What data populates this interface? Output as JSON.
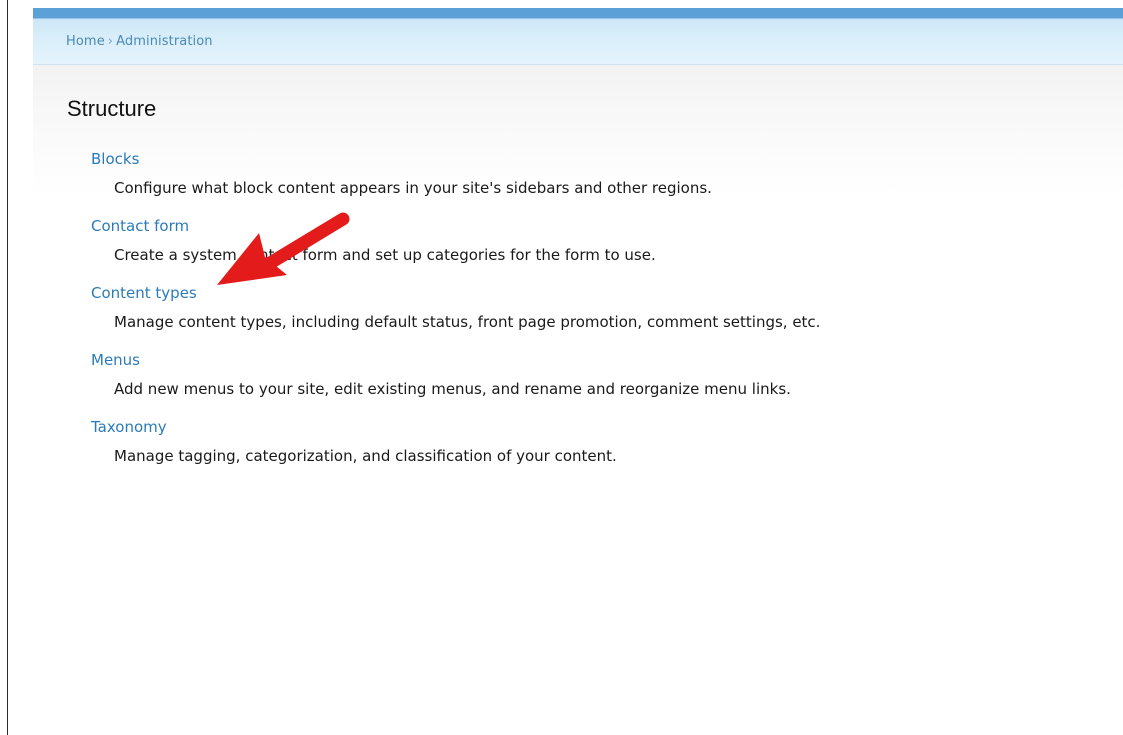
{
  "breadcrumb": {
    "home": "Home",
    "separator": "›",
    "current": "Administration"
  },
  "page": {
    "title": "Structure"
  },
  "items": [
    {
      "label": "Blocks",
      "description": "Configure what block content appears in your site's sidebars and other regions."
    },
    {
      "label": "Contact form",
      "description": "Create a system contact form and set up categories for the form to use."
    },
    {
      "label": "Content types",
      "description": "Manage content types, including default status, front page promotion, comment settings, etc."
    },
    {
      "label": "Menus",
      "description": "Add new menus to your site, edit existing menus, and rename and reorganize menu links."
    },
    {
      "label": "Taxonomy",
      "description": "Manage tagging, categorization, and classification of your content."
    }
  ],
  "annotation": {
    "type": "arrow-icon",
    "points_to": "Content types",
    "color": "#e31b1b"
  },
  "colors": {
    "link": "#2b7bb9",
    "breadcrumb": "#4a89b8",
    "header_top": "#5ba0d6",
    "header_bg": "#d9eefa"
  }
}
